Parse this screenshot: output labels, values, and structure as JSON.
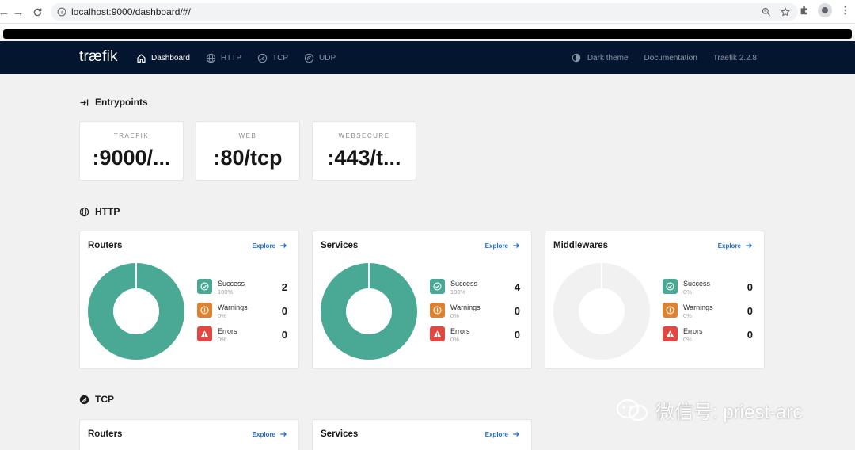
{
  "browser": {
    "url": "localhost:9000/dashboard/#/"
  },
  "navbar": {
    "logo": "træfik",
    "items": [
      {
        "label": "Dashboard",
        "icon": "home-icon",
        "active": true
      },
      {
        "label": "HTTP",
        "icon": "globe-icon",
        "active": false
      },
      {
        "label": "TCP",
        "icon": "tcp-icon",
        "active": false
      },
      {
        "label": "UDP",
        "icon": "udp-icon",
        "active": false
      }
    ],
    "dark_theme": "Dark theme",
    "documentation": "Documentation",
    "version": "Traefik 2.2.8"
  },
  "entrypoints": {
    "title": "Entrypoints",
    "items": [
      {
        "name": "TRAEFIK",
        "value": ":9000/..."
      },
      {
        "name": "WEB",
        "value": ":80/tcp"
      },
      {
        "name": "WEBSECURE",
        "value": ":443/t..."
      }
    ]
  },
  "http": {
    "title": "HTTP",
    "cards": [
      {
        "title": "Routers",
        "explore": "Explore",
        "success": {
          "label": "Success",
          "pct": "100%",
          "count": "2"
        },
        "warnings": {
          "label": "Warnings",
          "pct": "0%",
          "count": "0"
        },
        "errors": {
          "label": "Errors",
          "pct": "0%",
          "count": "0"
        },
        "donut_fill": 1.0
      },
      {
        "title": "Services",
        "explore": "Explore",
        "success": {
          "label": "Success",
          "pct": "100%",
          "count": "4"
        },
        "warnings": {
          "label": "Warnings",
          "pct": "0%",
          "count": "0"
        },
        "errors": {
          "label": "Errors",
          "pct": "0%",
          "count": "0"
        },
        "donut_fill": 1.0
      },
      {
        "title": "Middlewares",
        "explore": "Explore",
        "success": {
          "label": "Success",
          "pct": "0%",
          "count": "0"
        },
        "warnings": {
          "label": "Warnings",
          "pct": "0%",
          "count": "0"
        },
        "errors": {
          "label": "Errors",
          "pct": "0%",
          "count": "0"
        },
        "donut_fill": 0.0
      }
    ]
  },
  "tcp": {
    "title": "TCP",
    "cards": [
      {
        "title": "Routers",
        "explore": "Explore"
      },
      {
        "title": "Services",
        "explore": "Explore"
      }
    ]
  },
  "watermark": "微信号: priest-arc",
  "colors": {
    "success": "#4aa994",
    "warning": "#e0822d",
    "error": "#e24840",
    "empty": "#f1f1f1",
    "navbar": "#04162f",
    "link": "#1d6fd8"
  }
}
